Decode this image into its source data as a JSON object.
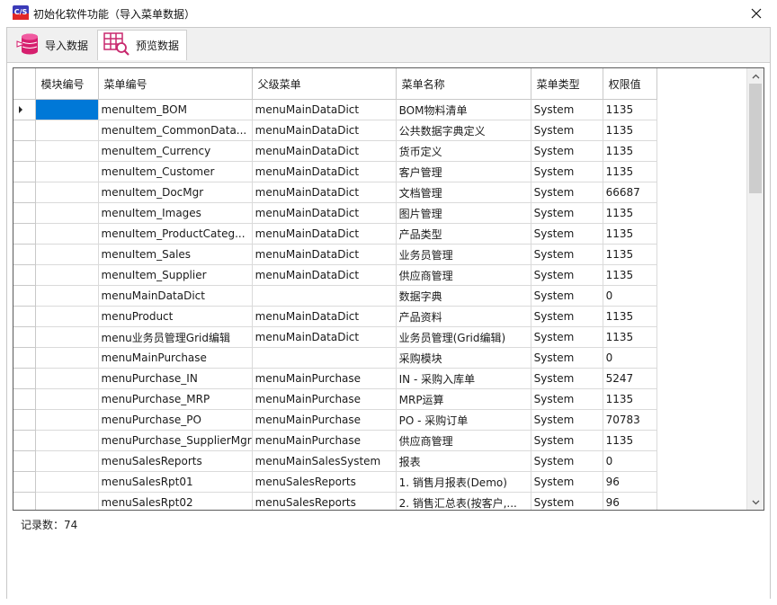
{
  "window": {
    "title": "初始化软件功能（导入菜单数据）",
    "app_icon_text": "C/S"
  },
  "tabs": [
    {
      "label": "导入数据",
      "icon": "database-import-icon",
      "active": false
    },
    {
      "label": "预览数据",
      "icon": "table-search-icon",
      "active": true
    }
  ],
  "grid": {
    "columns": [
      "模块编号",
      "菜单编号",
      "父级菜单",
      "菜单名称",
      "菜单类型",
      "权限值"
    ],
    "rows": [
      [
        "",
        "menuItem_BOM",
        "menuMainDataDict",
        "BOM物料清单",
        "System",
        "1135"
      ],
      [
        "",
        "menuItem_CommonData...",
        "menuMainDataDict",
        "公共数据字典定义",
        "System",
        "1135"
      ],
      [
        "",
        "menuItem_Currency",
        "menuMainDataDict",
        "货币定义",
        "System",
        "1135"
      ],
      [
        "",
        "menuItem_Customer",
        "menuMainDataDict",
        "客户管理",
        "System",
        "1135"
      ],
      [
        "",
        "menuItem_DocMgr",
        "menuMainDataDict",
        "文档管理",
        "System",
        "66687"
      ],
      [
        "",
        "menuItem_Images",
        "menuMainDataDict",
        "图片管理",
        "System",
        "1135"
      ],
      [
        "",
        "menuItem_ProductCateg...",
        "menuMainDataDict",
        "产品类型",
        "System",
        "1135"
      ],
      [
        "",
        "menuItem_Sales",
        "menuMainDataDict",
        "业务员管理",
        "System",
        "1135"
      ],
      [
        "",
        "menuItem_Supplier",
        "menuMainDataDict",
        "供应商管理",
        "System",
        "1135"
      ],
      [
        "",
        "menuMainDataDict",
        "",
        "数据字典",
        "System",
        "0"
      ],
      [
        "",
        "menuProduct",
        "menuMainDataDict",
        "产品资料",
        "System",
        "1135"
      ],
      [
        "",
        "menu业务员管理Grid编辑",
        "menuMainDataDict",
        "业务员管理(Grid编辑)",
        "System",
        "1135"
      ],
      [
        "",
        "menuMainPurchase",
        "",
        "采购模块",
        "System",
        "0"
      ],
      [
        "",
        "menuPurchase_IN",
        "menuMainPurchase",
        "IN - 采购入库单",
        "System",
        "5247"
      ],
      [
        "",
        "menuPurchase_MRP",
        "menuMainPurchase",
        "MRP运算",
        "System",
        "1135"
      ],
      [
        "",
        "menuPurchase_PO",
        "menuMainPurchase",
        "PO - 采购订单",
        "System",
        "70783"
      ],
      [
        "",
        "menuPurchase_SupplierMgr",
        "menuMainPurchase",
        "供应商管理",
        "System",
        "1135"
      ],
      [
        "",
        "menuSalesReports",
        "menuMainSalesSystem",
        "报表",
        "System",
        "0"
      ],
      [
        "",
        "menuSalesRpt01",
        "menuSalesReports",
        "1. 销售月报表(Demo)",
        "System",
        "96"
      ],
      [
        "",
        "menuSalesRpt02",
        "menuSalesReports",
        "2. 销售汇总表(按客户,...",
        "System",
        "96"
      ]
    ]
  },
  "status": {
    "record_count_label": "记录数：74"
  }
}
